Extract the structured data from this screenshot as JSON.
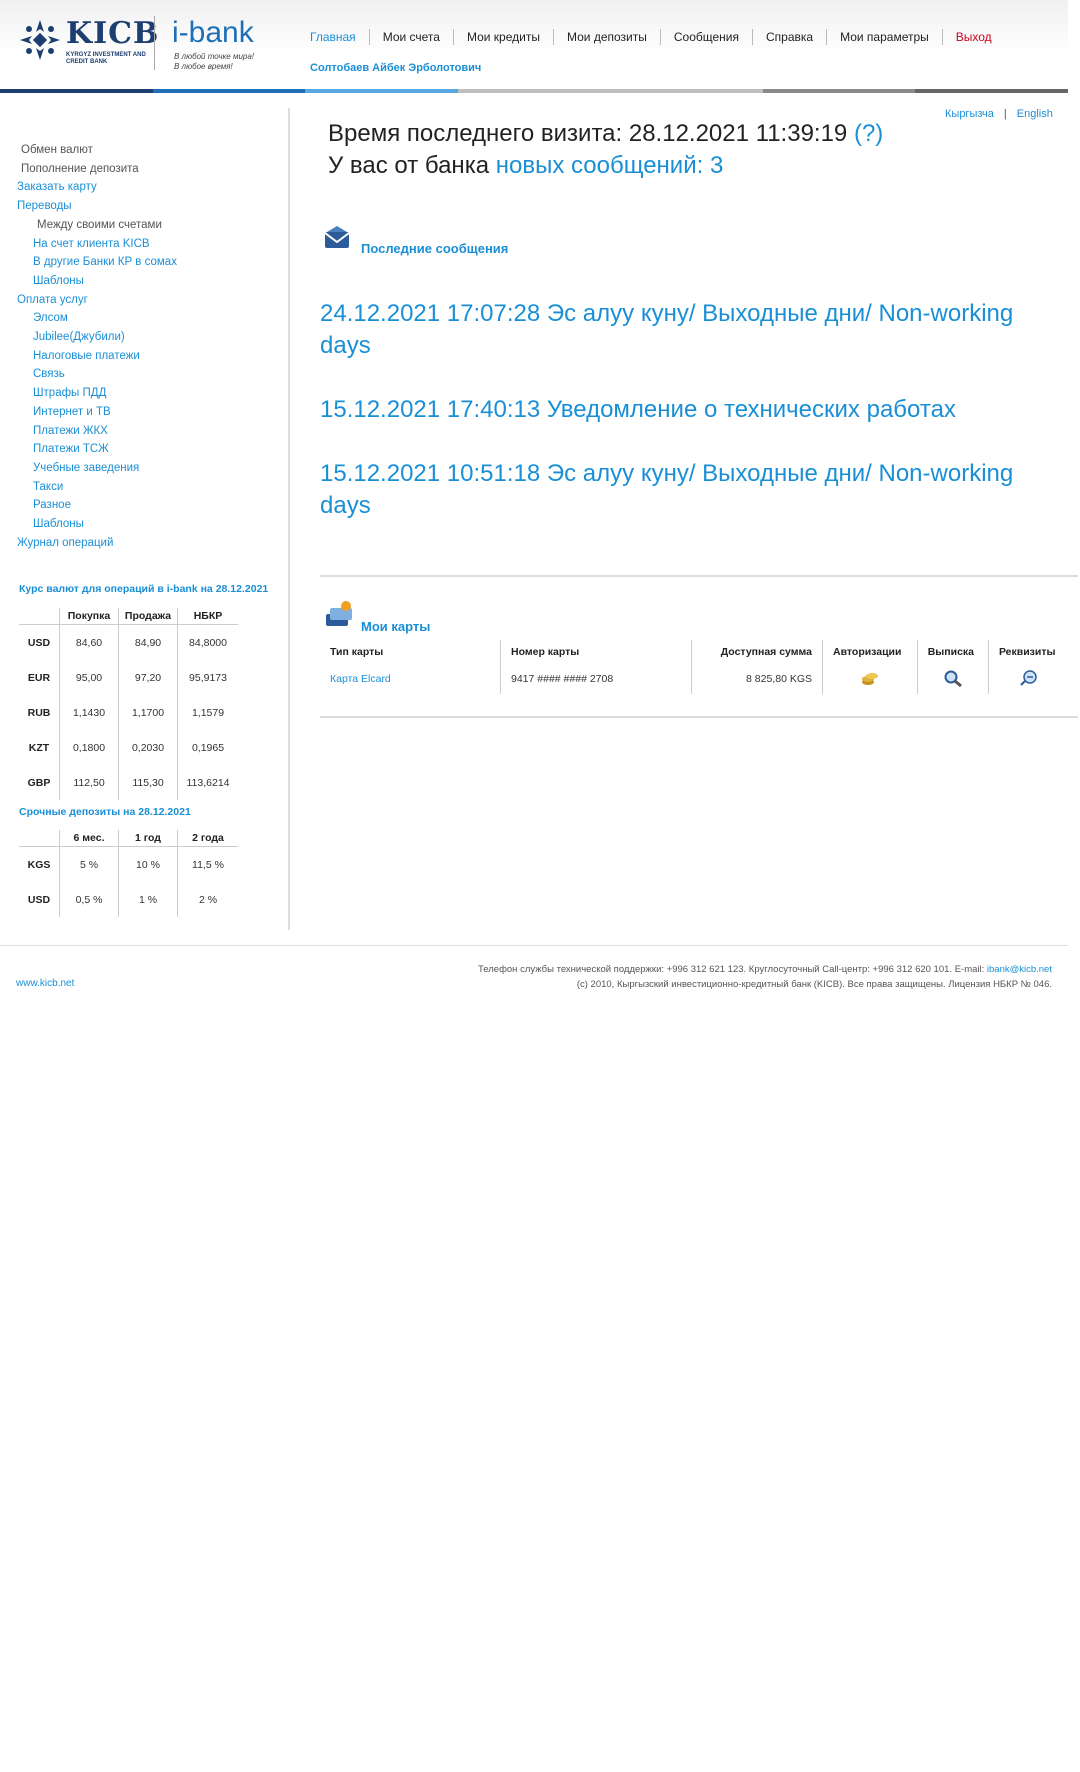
{
  "header": {
    "logo_name": "KICB",
    "logo_sub": "KYRGYZ INVESTMENT AND CREDIT BANK",
    "product": "i-bank",
    "slogan_1": "В любой точке мира!",
    "slogan_2": "В любое время!",
    "user_name": "Солтобаев Айбек Эрболотович",
    "bar_colors": [
      "#1d3e70",
      "#1d6fb8",
      "#59a9e0",
      "#bfbfbf",
      "#bfbfbf",
      "#8a8a8a",
      "#666666"
    ]
  },
  "nav": [
    {
      "label": "Главная"
    },
    {
      "label": "Мои счета"
    },
    {
      "label": "Мои кредиты"
    },
    {
      "label": "Мои депозиты"
    },
    {
      "label": "Сообщения"
    },
    {
      "label": "Справка"
    },
    {
      "label": "Мои параметры"
    },
    {
      "label": "Выход"
    }
  ],
  "lang": {
    "ky": "Кыргызча",
    "sep": "|",
    "en": "English"
  },
  "visit": {
    "prefix": "Время последнего визита: 28.12.2021 11:39:19",
    "help_link": "(?)",
    "msg_prefix": "У вас от банка",
    "msg_link": " новых сообщений: 3"
  },
  "sidebar": {
    "menu": [
      {
        "label": "Обмен валют",
        "type": "plain"
      },
      {
        "label": "Пополнение депозита",
        "type": "plain"
      },
      {
        "label": "Заказать карту",
        "type": "link"
      },
      {
        "label": "Переводы",
        "type": "link"
      },
      {
        "label": "Между своими счетами",
        "type": "sub-plain"
      },
      {
        "label": "На счет клиента KICB",
        "type": "sub-link"
      },
      {
        "label": "В другие Банки КР в сомах",
        "type": "sub-link"
      },
      {
        "label": "Шаблоны",
        "type": "sub-link"
      },
      {
        "label": "Оплата услуг",
        "type": "link"
      },
      {
        "label": "Элсом",
        "type": "sub-link"
      },
      {
        "label": "Jubilee(Джубили)",
        "type": "sub-link"
      },
      {
        "label": "Налоговые платежи",
        "type": "sub-link"
      },
      {
        "label": "Связь",
        "type": "sub-link"
      },
      {
        "label": "Штрафы ПДД",
        "type": "sub-link"
      },
      {
        "label": "Интернет и ТВ",
        "type": "sub-link"
      },
      {
        "label": "Платежи ЖКХ",
        "type": "sub-link"
      },
      {
        "label": "Платежи ТСЖ",
        "type": "sub-link"
      },
      {
        "label": "Учебные заведения",
        "type": "sub-link"
      },
      {
        "label": "Такси",
        "type": "sub-link"
      },
      {
        "label": "Разное",
        "type": "sub-link"
      },
      {
        "label": "Шаблоны",
        "type": "sub-link"
      },
      {
        "label": "Журнал операций",
        "type": "link"
      }
    ],
    "rates_title": "Курс валют для операций в i-bank на 28.12.2021",
    "rates_headers": [
      "",
      "Покупка",
      "Продажа",
      "НБКР"
    ],
    "rates": [
      [
        "USD",
        "84,60",
        "84,90",
        "84,8000"
      ],
      [
        "EUR",
        "95,00",
        "97,20",
        "95,9173"
      ],
      [
        "RUB",
        "1,1430",
        "1,1700",
        "1,1579"
      ],
      [
        "KZT",
        "0,1800",
        "0,2030",
        "0,1965"
      ],
      [
        "GBP",
        "112,50",
        "115,30",
        "113,6214"
      ]
    ],
    "deposits_title": "Срочные депозиты на 28.12.2021",
    "deposits_headers": [
      "",
      "6 мес.",
      "1 год",
      "2 года"
    ],
    "deposits": [
      [
        "KGS",
        "5 %",
        "10 %",
        "11,5 %"
      ],
      [
        "USD",
        "0,5 %",
        "1 %",
        "2 %"
      ]
    ]
  },
  "messages": {
    "title": "Последние сообщения",
    "items": [
      " 24.12.2021 17:07:28 Эс алуу куну/ Выходные дни/ Non-working days",
      " 15.12.2021 17:40:13 Уведомление о технических работах",
      " 15.12.2021 10:51:18 Эс алуу куну/ Выходные дни/ Non-working days"
    ]
  },
  "cards": {
    "title": "Мои карты",
    "headers": [
      "Тип карты",
      "Номер карты",
      "Доступная сумма",
      "Авторизации",
      "Выписка",
      "Реквизиты"
    ],
    "rows": [
      {
        "type": "Карта Elcard",
        "number": "9417 #### #### 2708",
        "amount": "8 825,80 KGS",
        "auth_icon": "coins-icon",
        "statement_icon": "magnifier-icon",
        "details_icon": "details-icon"
      }
    ]
  },
  "footer": {
    "site": "www.kicb.net",
    "support": "Телефон службы технической поддержки: +996 312 621 123. Круглосуточный Call-центр: +996 312 620 101. E-mail: ",
    "email": "ibank@kicb.net",
    "copyright": "(c) 2010, Кыргызский инвестиционно-кредитный банк (KICB). Все права защищены. Лицензия НБКР № 046."
  }
}
